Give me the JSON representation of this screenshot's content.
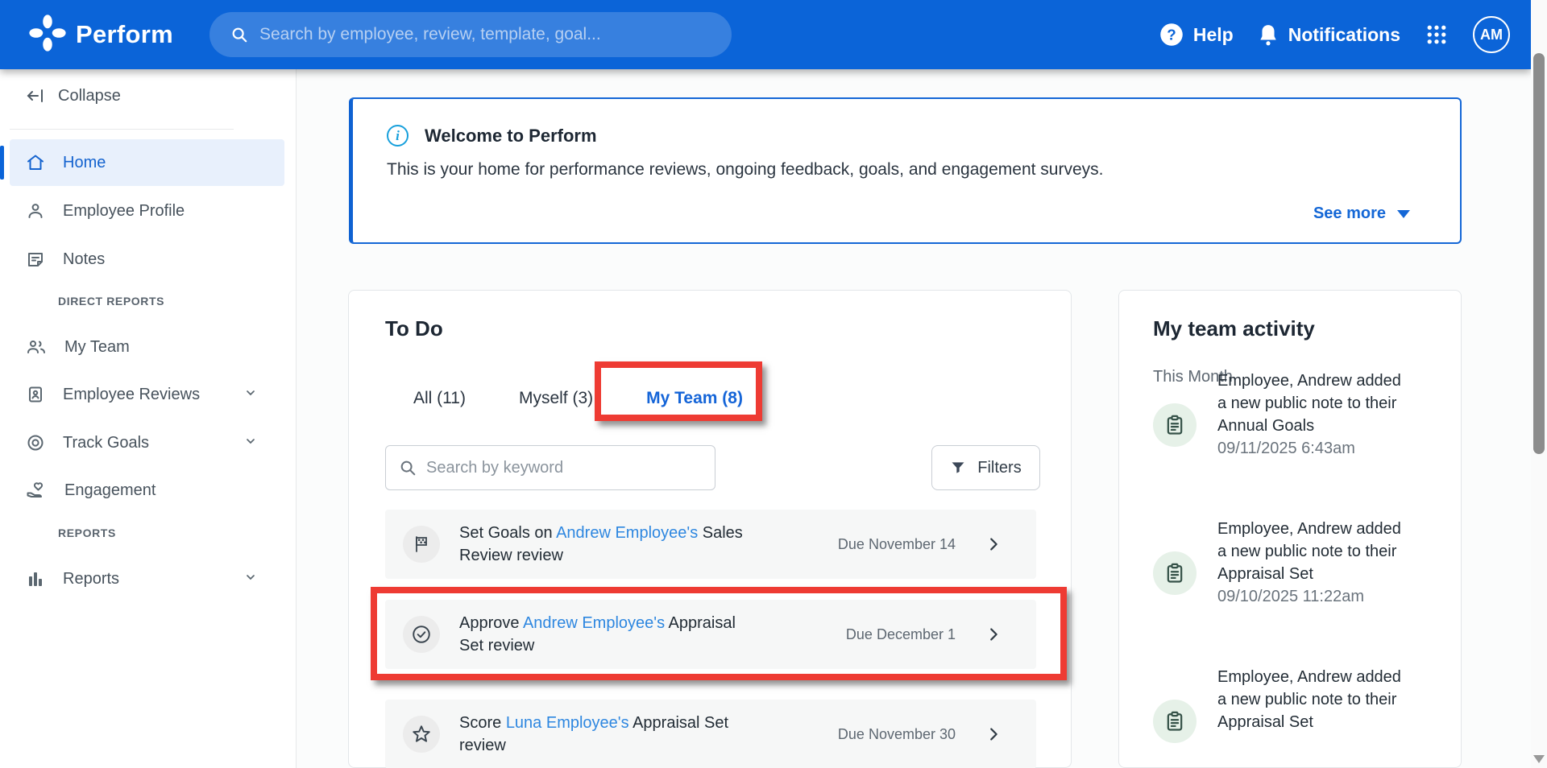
{
  "navbar": {
    "brand": "Perform",
    "search_placeholder": "Search by employee, review, template, goal...",
    "help_label": "Help",
    "notifications_label": "Notifications",
    "avatar_initials": "AM"
  },
  "sidebar": {
    "collapse_label": "Collapse",
    "sections": {
      "direct_reports": "DIRECT REPORTS",
      "reports": "REPORTS"
    },
    "items": [
      {
        "label": "Home",
        "icon": "home-icon",
        "active": true
      },
      {
        "label": "Employee Profile",
        "icon": "person-icon"
      },
      {
        "label": "Notes",
        "icon": "note-icon"
      },
      {
        "label": "My Team",
        "icon": "people-icon"
      },
      {
        "label": "Employee Reviews",
        "icon": "badge-icon",
        "has_chevron": true
      },
      {
        "label": "Track Goals",
        "icon": "target-icon",
        "has_chevron": true
      },
      {
        "label": "Engagement",
        "icon": "hand-heart-icon"
      },
      {
        "label": "Reports",
        "icon": "bar-chart-icon",
        "has_chevron": true
      }
    ]
  },
  "welcome": {
    "title": "Welcome to Perform",
    "body": "This is your home for performance reviews, ongoing feedback, goals, and engagement surveys.",
    "see_more_label": "See more"
  },
  "todo": {
    "title": "To Do",
    "tabs": [
      {
        "label": "All (11)"
      },
      {
        "label": "Myself (3)"
      },
      {
        "label": "My Team (8)",
        "active": true,
        "annotated": true
      }
    ],
    "search_placeholder": "Search by keyword",
    "filters_label": "Filters",
    "tasks": [
      {
        "icon": "flag-icon",
        "pre": "Set Goals on ",
        "link": "Andrew Employee's",
        "post": " Sales Review review",
        "due": "Due November 14"
      },
      {
        "icon": "check-circle-icon",
        "pre": "Approve ",
        "link": "Andrew Employee's",
        "post": " Appraisal Set review",
        "due": "Due December 1",
        "annotated": true
      },
      {
        "icon": "star-icon",
        "pre": "Score ",
        "link": "Luna Employee's",
        "post": " Appraisal Set review",
        "due": "Due November 30"
      }
    ]
  },
  "activity": {
    "title": "My team activity",
    "period": "This Month",
    "items": [
      {
        "text": "Employee, Andrew added a new public note to their Annual Goals",
        "timestamp": "09/11/2025 6:43am"
      },
      {
        "text": "Employee, Andrew added a new public note to their Appraisal Set",
        "timestamp": "09/10/2025 11:22am"
      },
      {
        "text": "Employee, Andrew added a new public note to their Appraisal Set",
        "timestamp": ""
      }
    ]
  },
  "colors": {
    "navbar_blue": "#0b64d8",
    "accent_blue": "#1565d8",
    "link_blue": "#2e87e0",
    "annotation_red": "#ee3b33",
    "active_item_bg": "#e8f0fc",
    "activity_icon_bg": "#e6f1e8",
    "activity_icon_fg": "#355248"
  }
}
